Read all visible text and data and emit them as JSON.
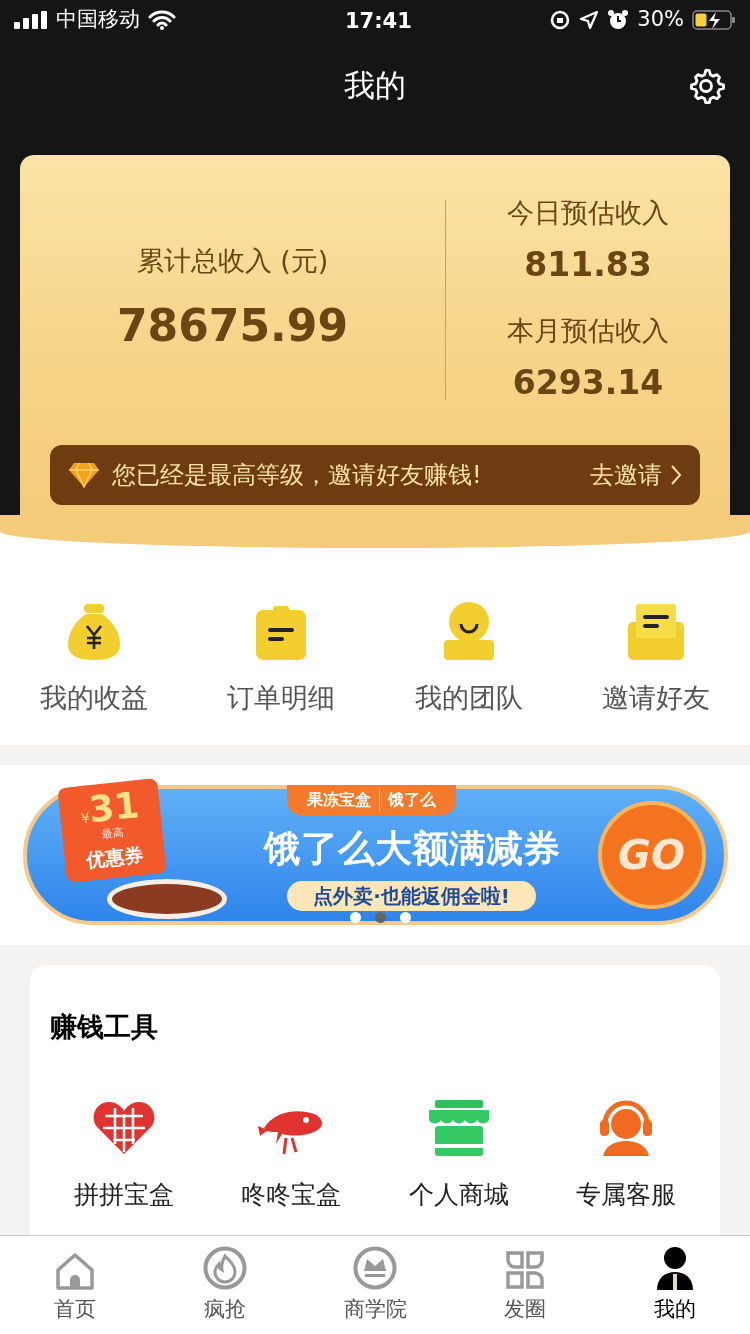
{
  "status_bar": {
    "carrier": "中国移动",
    "time": "17:41",
    "battery": "30%"
  },
  "header": {
    "title": "我的"
  },
  "income_card": {
    "total_label": "累计总收入 (元)",
    "total_value": "78675.99",
    "stats": [
      {
        "label": "今日预估收入",
        "value": "811.83"
      },
      {
        "label": "本月预估收入",
        "value": "6293.14"
      }
    ],
    "invite_bar": {
      "text": "您已经是最高等级，邀请好友赚钱!",
      "action": "去邀请"
    }
  },
  "quick_actions": [
    {
      "kind": "money",
      "label": "我的收益"
    },
    {
      "kind": "order",
      "label": "订单明细"
    },
    {
      "kind": "team",
      "label": "我的团队"
    },
    {
      "kind": "invite",
      "label": "邀请好友"
    }
  ],
  "banner": {
    "brand": "果冻宝盒",
    "partner": "饿了么",
    "headline": "饿了么大额满减券",
    "subline": "点外卖·也能返佣金啦!",
    "coupon_amount": "31",
    "coupon_currency": "¥",
    "coupon_tag": "最高",
    "coupon_label": "优惠券",
    "go": "GO",
    "dots": [
      {
        "selected": false
      },
      {
        "selected": true
      },
      {
        "selected": false
      }
    ]
  },
  "tools": {
    "title": "赚钱工具",
    "items": [
      {
        "kind": "pdd",
        "label": "拼拼宝盒"
      },
      {
        "kind": "jd",
        "label": "咚咚宝盒"
      },
      {
        "kind": "shop",
        "label": "个人商城"
      },
      {
        "kind": "service",
        "label": "专属客服"
      }
    ]
  },
  "tab_bar": [
    {
      "kind": "home",
      "label": "首页",
      "selected": false
    },
    {
      "kind": "fire",
      "label": "疯抢",
      "selected": false
    },
    {
      "kind": "crown",
      "label": "商学院",
      "selected": false
    },
    {
      "kind": "grid",
      "label": "发圈",
      "selected": false
    },
    {
      "kind": "user",
      "label": "我的",
      "selected": true
    }
  ]
}
